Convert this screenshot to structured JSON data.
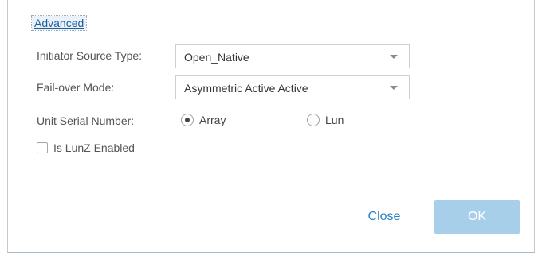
{
  "advanced_link": "Advanced",
  "initiator": {
    "label": "Initiator Source Type:",
    "value": "Open_Native"
  },
  "failover": {
    "label": "Fail-over Mode:",
    "value": "Asymmetric Active Active"
  },
  "serial": {
    "label": "Unit Serial Number:",
    "options": [
      {
        "label": "Array",
        "selected": true
      },
      {
        "label": "Lun",
        "selected": false
      }
    ]
  },
  "lunz": {
    "label": "Is LunZ Enabled",
    "checked": false
  },
  "buttons": {
    "close": "Close",
    "ok": "OK",
    "ok_enabled": false
  },
  "colors": {
    "link": "#1a5f9e",
    "close_text": "#2a7fc4",
    "ok_background_disabled": "#a8cfea"
  }
}
